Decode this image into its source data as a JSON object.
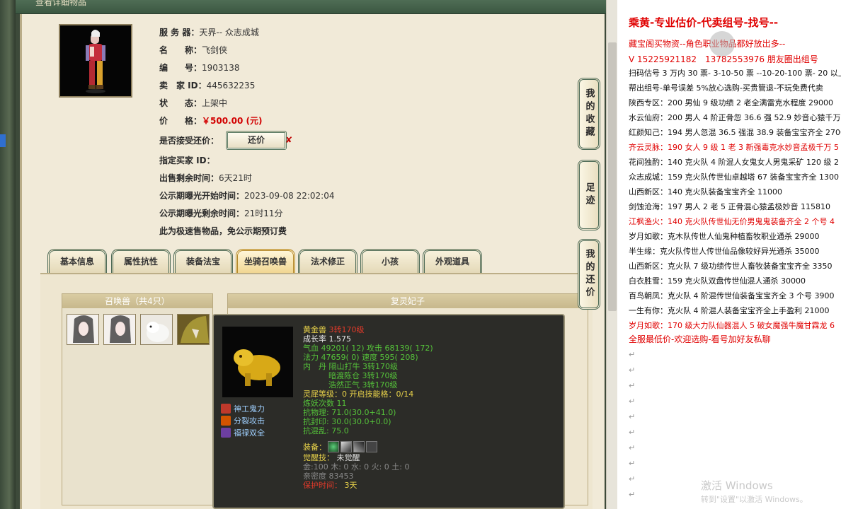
{
  "window": {
    "title": "查看详细物品"
  },
  "item": {
    "rows": [
      {
        "key": "服 务 器：",
        "value": "天界-- 众志成城"
      },
      {
        "key": "名　　称：",
        "value": "飞剑侠"
      },
      {
        "key": "编　　号：",
        "value": "1903138"
      },
      {
        "key": "卖　家 ID：",
        "value": "445632235"
      },
      {
        "key": "状　　态：",
        "value": "上架中"
      }
    ],
    "price_key": "价　　格：",
    "price_value": "￥500.00 (元)",
    "counter_question": "是否接受还价：",
    "counter_button": "还价",
    "counter_mark": "✘",
    "rows2": [
      {
        "key": "指定买家 ID：",
        "value": ""
      },
      {
        "key": "出售剩余时间：",
        "value": "6天21时"
      },
      {
        "key": "公示期曝光开始时间：",
        "value": "2023-09-08 22:02:04"
      },
      {
        "key": "公示期曝光剩余时间：",
        "value": "21时11分"
      }
    ],
    "fast_sale_note": "此为极速售物品，免公示期预订费"
  },
  "tabs": [
    "基本信息",
    "属性抗性",
    "装备法宝",
    "坐骑召唤兽",
    "法术修正",
    "小孩",
    "外观道具"
  ],
  "active_tab": "坐骑召唤兽",
  "pets": {
    "header": "召唤兽（共4只）",
    "thumbs": [
      "pet-1",
      "pet-2",
      "pet-3",
      "pet-4"
    ]
  },
  "detail": {
    "header": "复灵妃子"
  },
  "side_buttons": [
    "我的收藏",
    "足迹",
    "我的还价"
  ],
  "tooltip": {
    "name": "黄金兽",
    "level": "3转170级",
    "growth": "成长率 1.575",
    "hp": "气血 49201( 12) 攻击 68139( 172)",
    "mp": "法力 47659( 0) 速度 595( 208)",
    "dan1_label": "内　丹",
    "dan1": "隔山打牛 3转170级",
    "dan2": "暗渡陈仓 3转170级",
    "dan3": "浩然正气 3转170级",
    "soul": "灵犀等级：0 开启技能格：0/14",
    "refine": "炼妖次数 11",
    "res1": "抗物理: 71.0(30.0+41.0)",
    "res2": "抗封印: 30.0(30.0+0.0)",
    "res3": "抗混乱: 75.0",
    "equip_label": "装备：",
    "awaken_label": "觉醒技：",
    "awaken_value": "未觉醒",
    "elements": "金:100 木: 0 水: 0 火: 0 土: 0",
    "intimacy": "亲密度 83453",
    "protect_label": "保护时间：",
    "protect_value": "3天",
    "skills": [
      "神工鬼力",
      "分裂攻击",
      "福禄双全"
    ]
  },
  "notes": {
    "title": "乘黄-专业估价-代卖组号-找号--",
    "line2": "藏宝阁买物资--角色职业物品都好放出多--",
    "line3": "V 15225921182　13782553976 朋友圈出组号",
    "lines": [
      {
        "text": "扫码估号 3 万内 30 票- 3-10-50 票 --10-20-100 票- 20 以上",
        "red": false
      },
      {
        "text": "帮出组号-单号误差 5%放心选购-买贵管退-不玩免费代卖",
        "red": false
      },
      {
        "text": "陕西专区：200 男仙 9 级功绩 2 老全满雷克水程度 29000",
        "red": false
      },
      {
        "text": "水云仙府：200 男人 4 阶正骨忽 36.6 强 52.9 妙音心猿千万",
        "red": false
      },
      {
        "text": "红颜知己：194 男人忽混 36.5 强混 38.9 装备宝宝齐全 2700",
        "red": false
      },
      {
        "text": "齐云灵脉：190 女人 9 级 1 老 3 新强毒克水妙音孟极千万 5",
        "red": true
      },
      {
        "text": "花间独酌：140 克火队 4 阶混人女鬼女人男鬼采矿 120 级 2",
        "red": false
      },
      {
        "text": "众志成城：159 克火队传世仙卓越塔 67 装备宝宝齐全 1300",
        "red": false
      },
      {
        "text": "山西新区：140 克火队装备宝宝齐全 11000",
        "red": false
      },
      {
        "text": "剑蚀沧海：197 男人 2 老 5 正骨混心猿孟极妙音 115810",
        "red": false
      },
      {
        "text": "江枫渔火：140 克火队传世仙无价男鬼鬼装备齐全 2 个号 4",
        "red": true
      },
      {
        "text": "岁月如歌：克木队传世人仙鬼种植畜牧职业通杀 29000",
        "red": false
      },
      {
        "text": "半生缘：克火队传世人传世仙品像较好异光通杀 35000",
        "red": false
      },
      {
        "text": "山西新区：克火队 7 级功绩传世人畜牧装备宝宝齐全 3350",
        "red": false
      },
      {
        "text": "白衣胜雪：159 克火队双盘传世仙混人通杀 30000",
        "red": false
      },
      {
        "text": "百鸟朝凤：克火队 4 阶混传世仙装备宝宝齐全 3 个号 3900",
        "red": false
      },
      {
        "text": "一生有你：克火队 4 阶混人装备宝宝齐全上手盈利 21000",
        "red": false
      },
      {
        "text": "岁月如歌：170 级大力队仙器混人 5 破女魔强牛魔甘霖龙 6",
        "red": true
      }
    ],
    "closing": "全服最低价-欢迎选购-看号加好友私聊",
    "pilcrow": "↵",
    "watermark_title": "激活 Windows",
    "watermark_sub": "转到\"设置\"以激活 Windows。"
  }
}
